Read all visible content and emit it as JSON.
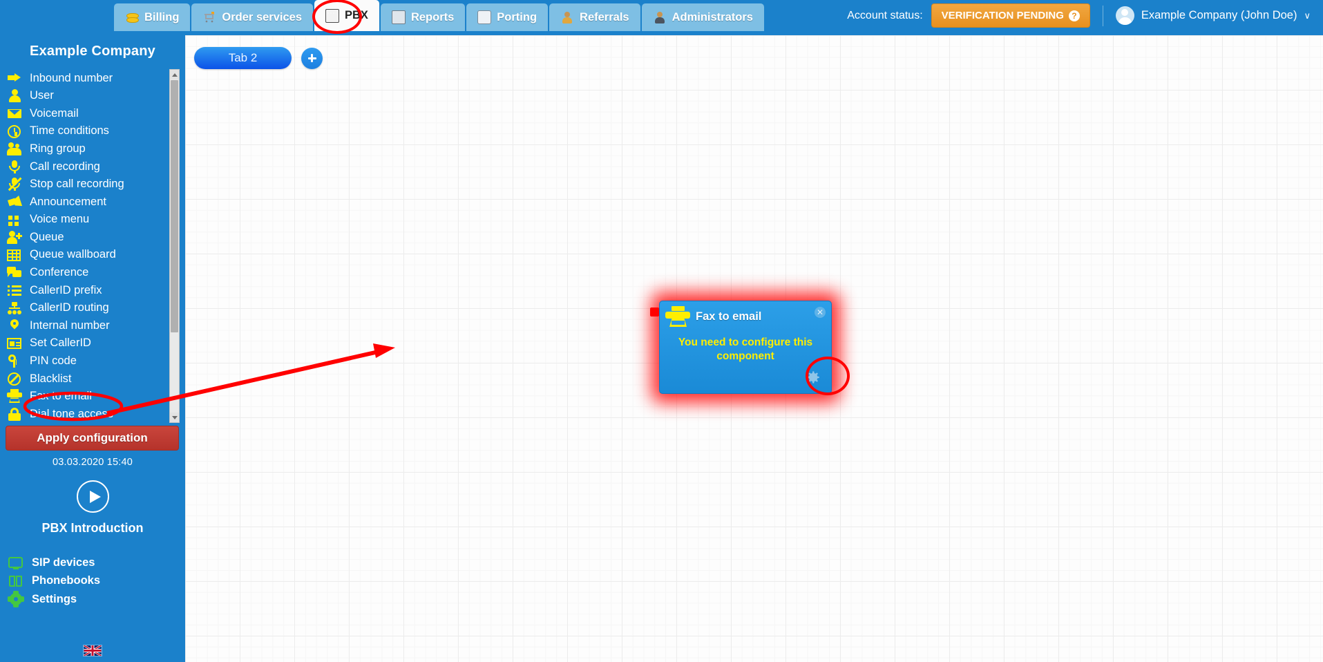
{
  "header": {
    "tabs": [
      {
        "label": "Billing",
        "icon": "coins-icon",
        "active": false
      },
      {
        "label": "Order services",
        "icon": "shopping-cart-icon",
        "active": false
      },
      {
        "label": "PBX",
        "icon": "pbx-device-icon",
        "active": true
      },
      {
        "label": "Reports",
        "icon": "reports-icon",
        "active": false
      },
      {
        "label": "Porting",
        "icon": "mobile-phone-icon",
        "active": false
      },
      {
        "label": "Referrals",
        "icon": "user-gold-icon",
        "active": false
      },
      {
        "label": "Administrators",
        "icon": "user-admin-icon",
        "active": false
      }
    ],
    "account_status_label": "Account status:",
    "status_badge": "VERIFICATION PENDING",
    "status_badge_help": "?",
    "user_name": "Example Company (John Doe)",
    "chevron": "∨"
  },
  "sidebar": {
    "company": "Example Company",
    "menu": [
      {
        "label": "Inbound number",
        "icon": "arrow-right-icon"
      },
      {
        "label": "User",
        "icon": "user-icon"
      },
      {
        "label": "Voicemail",
        "icon": "envelope-icon"
      },
      {
        "label": "Time conditions",
        "icon": "clock-icon"
      },
      {
        "label": "Ring group",
        "icon": "users-group-icon"
      },
      {
        "label": "Call recording",
        "icon": "microphone-icon"
      },
      {
        "label": "Stop call recording",
        "icon": "microphone-muted-icon"
      },
      {
        "label": "Announcement",
        "icon": "megaphone-icon"
      },
      {
        "label": "Voice menu",
        "icon": "grid-squares-icon"
      },
      {
        "label": "Queue",
        "icon": "user-plus-icon"
      },
      {
        "label": "Queue wallboard",
        "icon": "table-grid-icon"
      },
      {
        "label": "Conference",
        "icon": "chat-bubbles-icon"
      },
      {
        "label": "CallerID prefix",
        "icon": "list-bullets-icon"
      },
      {
        "label": "CallerID routing",
        "icon": "tree-routing-icon"
      },
      {
        "label": "Internal number",
        "icon": "map-pin-icon"
      },
      {
        "label": "Set CallerID",
        "icon": "id-card-icon"
      },
      {
        "label": "PIN code",
        "icon": "key-icon"
      },
      {
        "label": "Blacklist",
        "icon": "ban-circle-icon"
      },
      {
        "label": "Fax to email",
        "icon": "fax-printer-icon"
      },
      {
        "label": "Dial tone access",
        "icon": "padlock-icon"
      }
    ],
    "apply_button": "Apply configuration",
    "apply_timestamp": "03.03.2020 15:40",
    "intro_label": "PBX Introduction",
    "bottom_links": [
      {
        "label": "SIP devices",
        "icon": "monitor-icon"
      },
      {
        "label": "Phonebooks",
        "icon": "open-book-icon"
      },
      {
        "label": "Settings",
        "icon": "gear-icon"
      }
    ],
    "language_flag": "uk-flag-icon"
  },
  "canvas": {
    "tab_label": "Tab 2",
    "add_tab_icon": "plus-circle-icon",
    "node": {
      "title": "Fax to email",
      "icon": "fax-printer-icon",
      "message": "You need to configure this component",
      "close_icon": "close-icon",
      "settings_icon": "gear-icon"
    }
  },
  "annotations": {
    "highlight_menu_item": "Fax to email",
    "highlight_tab": "PBX",
    "highlight_gear": "node settings gear"
  },
  "colors": {
    "brand_blue": "#1b81cb",
    "tab_inactive": "#7ebfe4",
    "accent_yellow": "#ffee00",
    "status_orange": "#e8901f",
    "apply_red": "#b5332b",
    "annotation_red": "#ff0000",
    "green": "#44c740"
  }
}
